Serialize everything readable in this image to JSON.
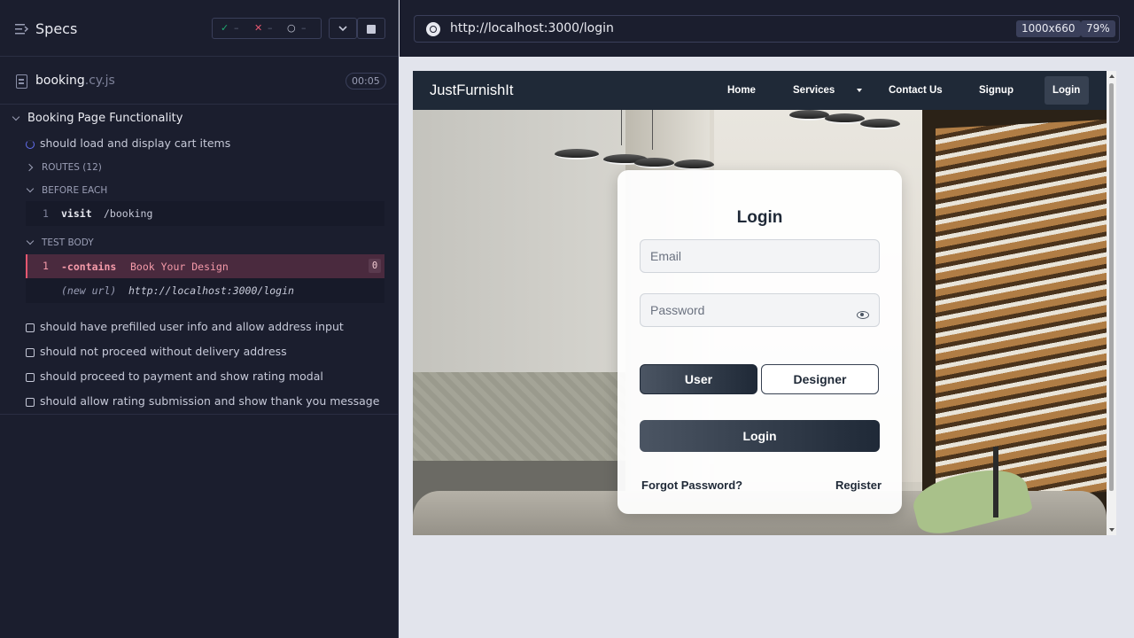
{
  "runner": {
    "header": {
      "title": "Specs"
    },
    "stats": {
      "passed": "–",
      "failed": "–",
      "pending": "–"
    },
    "spec": {
      "name": "booking",
      "ext": ".cy.js",
      "duration": "00:05"
    },
    "suite": {
      "title": "Booking Page Functionality",
      "running_test": "should load and display cart items",
      "routes_label": "ROUTES (12)",
      "before_each_label": "BEFORE EACH",
      "before_each_cmd": {
        "num": "1",
        "name": "visit",
        "arg": "/booking"
      },
      "test_body_label": "TEST BODY",
      "failed_cmd": {
        "num": "1",
        "name": "-contains",
        "arg": "Book Your Design",
        "count": "0"
      },
      "new_url": {
        "label": "(new url)",
        "value": "http://localhost:3000/login"
      },
      "other_tests": [
        "should have prefilled user info and allow address input",
        "should not proceed without delivery address",
        "should proceed to payment and show rating modal",
        "should allow rating submission and show thank you message"
      ]
    }
  },
  "browser": {
    "url": "http://localhost:3000/login",
    "viewport": "1000x660",
    "zoom": "79%"
  },
  "app": {
    "brand": "JustFurnishIt",
    "nav": [
      "Home",
      "Services",
      "Contact Us",
      "Signup",
      "Login"
    ],
    "login": {
      "title": "Login",
      "email_placeholder": "Email",
      "password_placeholder": "Password",
      "role_user": "User",
      "role_designer": "Designer",
      "submit": "Login",
      "forgot": "Forgot Password?",
      "register": "Register"
    }
  },
  "colors": {
    "runner_bg": "#1b1e2e",
    "fail_accent": "#e45770",
    "pass_accent": "#1fa971",
    "navbar_bg": "#1f2937"
  }
}
